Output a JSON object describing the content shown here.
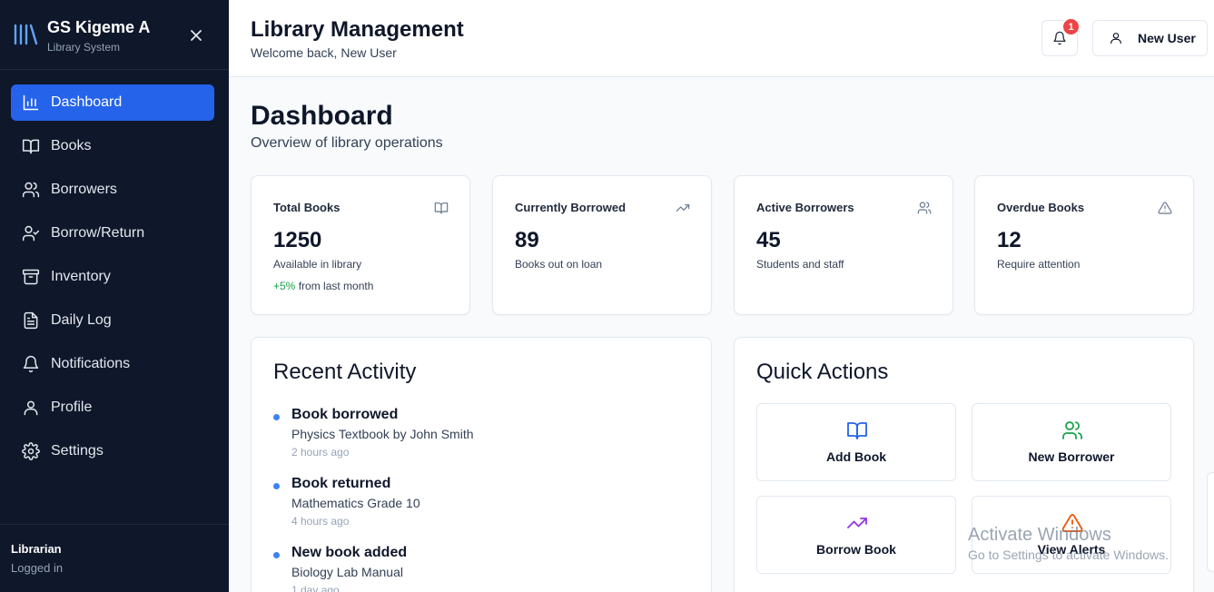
{
  "sidebar": {
    "brand_title": "GS Kigeme A",
    "brand_subtitle": "Library System",
    "items": [
      {
        "label": "Dashboard",
        "icon": "bar-chart-icon",
        "active": true
      },
      {
        "label": "Books",
        "icon": "book-open-icon"
      },
      {
        "label": "Borrowers",
        "icon": "users-icon"
      },
      {
        "label": "Borrow/Return",
        "icon": "user-check-icon"
      },
      {
        "label": "Inventory",
        "icon": "archive-icon"
      },
      {
        "label": "Daily Log",
        "icon": "file-text-icon"
      },
      {
        "label": "Notifications",
        "icon": "bell-icon"
      },
      {
        "label": "Profile",
        "icon": "user-icon"
      },
      {
        "label": "Settings",
        "icon": "gear-icon"
      }
    ],
    "footer_role": "Librarian",
    "footer_status": "Logged in"
  },
  "header": {
    "title": "Library Management",
    "subtitle": "Welcome back, New User",
    "notification_count": "1",
    "user_button_label": "New User"
  },
  "main": {
    "title": "Dashboard",
    "subtitle": "Overview of library operations",
    "stats": [
      {
        "label": "Total Books",
        "value": "1250",
        "desc": "Available in library",
        "trend_value": "+5%",
        "trend_text": " from last month",
        "icon": "book-open-icon"
      },
      {
        "label": "Currently Borrowed",
        "value": "89",
        "desc": "Books out on loan",
        "icon": "trending-up-icon"
      },
      {
        "label": "Active Borrowers",
        "value": "45",
        "desc": "Students and staff",
        "icon": "users-icon"
      },
      {
        "label": "Overdue Books",
        "value": "12",
        "desc": "Require attention",
        "icon": "alert-triangle-icon"
      }
    ],
    "recent_activity": {
      "title": "Recent Activity",
      "items": [
        {
          "title": "Book borrowed",
          "detail": "Physics Textbook by John Smith",
          "time": "2 hours ago"
        },
        {
          "title": "Book returned",
          "detail": "Mathematics Grade 10",
          "time": "4 hours ago"
        },
        {
          "title": "New book added",
          "detail": "Biology Lab Manual",
          "time": "1 day ago"
        }
      ]
    },
    "quick_actions": {
      "title": "Quick Actions",
      "items": [
        {
          "label": "Add Book",
          "icon": "book-open-icon",
          "color": "#2563eb"
        },
        {
          "label": "New Borrower",
          "icon": "users-icon",
          "color": "#16a34a"
        },
        {
          "label": "Borrow Book",
          "icon": "trending-up-icon",
          "color": "#9333ea"
        },
        {
          "label": "View Alerts",
          "icon": "alert-triangle-icon",
          "color": "#ea580c"
        }
      ]
    }
  },
  "watermark": {
    "title": "Activate Windows",
    "subtitle": "Go to Settings to activate Windows."
  }
}
